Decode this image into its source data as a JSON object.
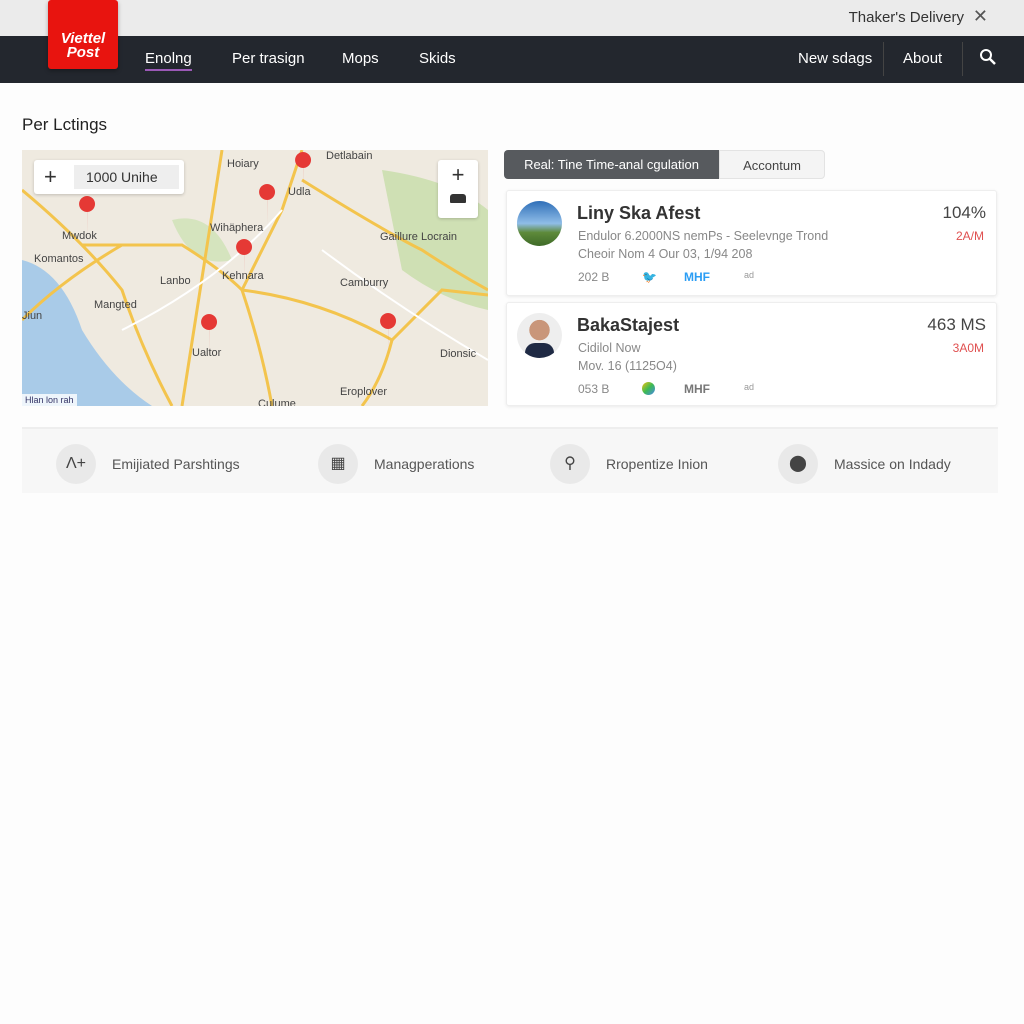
{
  "window": {
    "title": "Thaker's Delivery",
    "close_icon": "close-icon"
  },
  "logo": {
    "line1": "Viettel",
    "line2": "Post"
  },
  "nav": {
    "items": [
      {
        "label": "Enolng",
        "active": true
      },
      {
        "label": "Per trasign"
      },
      {
        "label": "Mops"
      },
      {
        "label": "Skids"
      }
    ],
    "right": [
      {
        "label": "New sdags"
      },
      {
        "label": "About"
      }
    ],
    "search_icon": "search-icon"
  },
  "page": {
    "title": "Per Lctings"
  },
  "map": {
    "scale_value": "1000 Unihe",
    "zoom_in": "+",
    "attribution": "Hlan lon rah",
    "labels": [
      "Hoiary",
      "Detlabain",
      "Udla",
      "Wihäphera",
      "Mwdok",
      "Komantos",
      "Gaillure Locrain",
      "Lanbo",
      "Kehnara",
      "Camburry",
      "Mangted",
      "Jiun",
      "Ualtor",
      "Dionsic",
      "Eroplover",
      "Culume"
    ],
    "pin_color": "#e53935"
  },
  "tabs": [
    {
      "label": "Real: Tine Time-anal cgulation",
      "active": true
    },
    {
      "label": "Accontum"
    }
  ],
  "cards": [
    {
      "name": "Liny Ska Afest",
      "line1": "Endulor 6.2000NS nemPs - Seelevnge Trond",
      "line2": "Cheoir Nom 4 Our 03, 1/94 208",
      "meta": "202 B",
      "icons": [
        "twitter-icon",
        "MHF",
        "ad"
      ],
      "value": "104%",
      "sub": "2A/M"
    },
    {
      "name": "BakaStajest",
      "line1": "Cidilol Now",
      "line2": "Mov. 16 (1125O4)",
      "meta": "053 B",
      "icons": [
        "colorful-icon",
        "MHF",
        "ad"
      ],
      "value": "463 MS",
      "sub": "3A0M"
    }
  ],
  "features": [
    {
      "icon": "text-add-icon",
      "glyph": "Λ+",
      "label": "Emijiated Parshtings"
    },
    {
      "icon": "grid-icon",
      "glyph": "▦",
      "label": "Managperations"
    },
    {
      "icon": "key-icon",
      "glyph": "⚲",
      "label": "Rropentize Inion"
    },
    {
      "icon": "pin-badge-icon",
      "glyph": "⬤",
      "label": "Massice on Indady"
    }
  ],
  "colors": {
    "nav_bg": "#23272e",
    "brand": "#e8140f",
    "tab_active": "#575a5e",
    "accent_red": "#e05050"
  }
}
